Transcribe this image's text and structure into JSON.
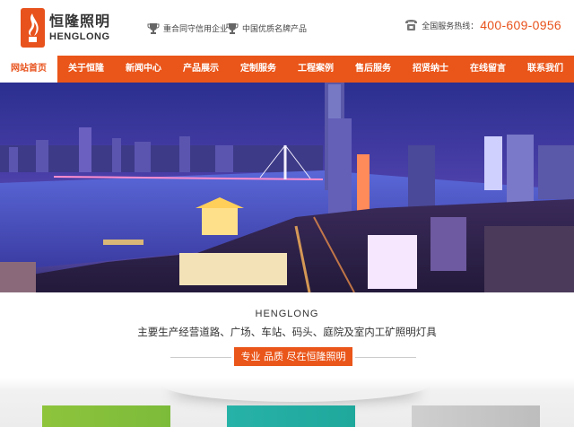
{
  "header": {
    "logo_cn": "恒隆照明",
    "logo_en": "HENGLONG",
    "badges": [
      {
        "icon": "trophy-icon",
        "label": "重合同守信用企业"
      },
      {
        "icon": "trophy-icon",
        "label": "中国优质名牌产品"
      }
    ],
    "hotline": {
      "icon": "phone-icon",
      "label": "全国服务热线：",
      "number": "400-609-0956"
    }
  },
  "nav": {
    "items": [
      {
        "label": "网站首页",
        "active": true
      },
      {
        "label": "关于恒隆"
      },
      {
        "label": "新闻中心"
      },
      {
        "label": "产品展示"
      },
      {
        "label": "定制服务"
      },
      {
        "label": "工程案例"
      },
      {
        "label": "售后服务"
      },
      {
        "label": "招贤纳士"
      },
      {
        "label": "在线留言"
      },
      {
        "label": "联系我们"
      }
    ]
  },
  "intro": {
    "title": "HENGLONG",
    "subtitle": "主要生产经营道路、广场、车站、码头、庭院及室内工矿照明灯具",
    "slogan": "专业 品质 尽在恒隆照明"
  },
  "colors": {
    "accent": "#ea5519",
    "nav_bg": "#ea5519"
  }
}
